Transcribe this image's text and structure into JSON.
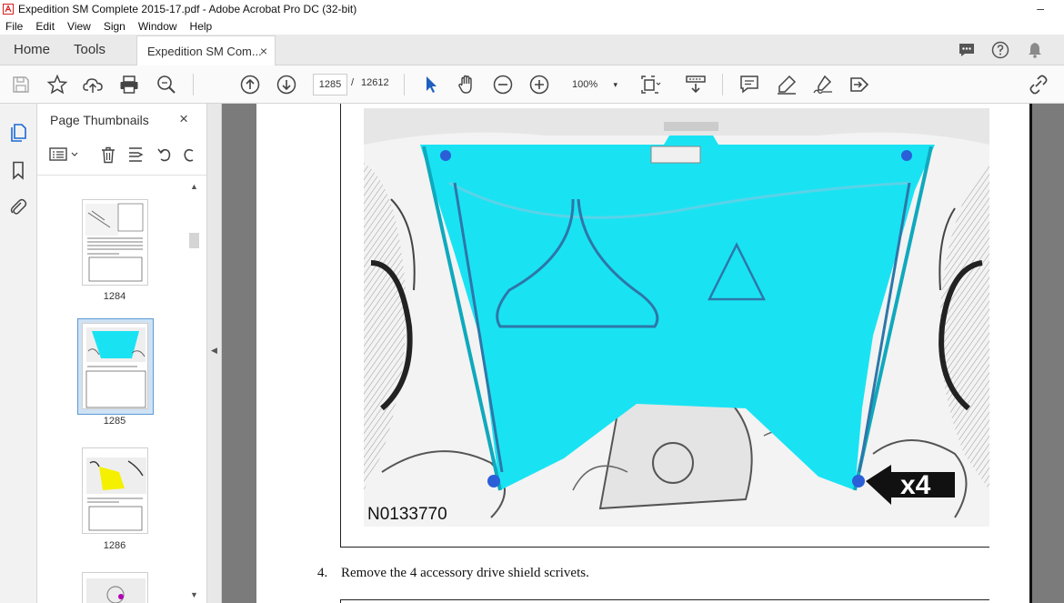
{
  "window": {
    "title": "Expedition SM Complete 2015-17.pdf - Adobe Acrobat Pro DC (32-bit)",
    "minimize": "–"
  },
  "menu": [
    "File",
    "Edit",
    "View",
    "Sign",
    "Window",
    "Help"
  ],
  "tabs": {
    "home": "Home",
    "tools": "Tools",
    "document": "Expedition SM Com...",
    "close": "×"
  },
  "toolbar": {
    "current_page": "1285",
    "page_separator": "/",
    "total_pages": "12612",
    "zoom": "100%",
    "zoom_caret": "▾"
  },
  "thumbnails_panel": {
    "title": "Page Thumbnails",
    "close": "×",
    "pages": [
      {
        "label": "1284"
      },
      {
        "label": "1285",
        "selected": true
      },
      {
        "label": "1286"
      }
    ]
  },
  "document": {
    "figure_id": "N0133770",
    "callout": "x4",
    "step_number": "4.",
    "step_text": "Remove the 4 accessory drive shield scrivets."
  },
  "colors": {
    "highlight_cyan": "#19e3f3",
    "acrobat_red": "#d6201f",
    "selection_blue": "#5b9bd5"
  },
  "icons": [
    "save-icon",
    "star-icon",
    "upload-icon",
    "print-icon",
    "zoom-search-icon",
    "page-up-icon",
    "page-down-icon",
    "select-arrow-icon",
    "hand-icon",
    "zoom-out-icon",
    "zoom-in-icon",
    "fit-page-icon",
    "scroll-mode-icon",
    "comment-icon",
    "highlight-pen-icon",
    "sign-icon",
    "send-icon",
    "share-link-icon"
  ]
}
